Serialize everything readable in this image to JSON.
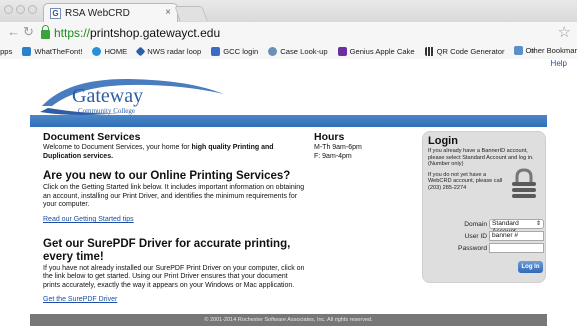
{
  "browser": {
    "tab_title": "RSA WebCRD",
    "tab_favicon": "G",
    "tab_close": "×",
    "url_scheme": "https://",
    "url_host": "printshop.gatewayct.edu",
    "bookmarks": [
      {
        "label": "Apps",
        "icon": "apps-grid-icon",
        "color": "#3a7bd5"
      },
      {
        "label": "WhatTheFont!",
        "icon": "whatthefont-icon",
        "color": "#2e7fc9"
      },
      {
        "label": "HOME",
        "icon": "home-icon",
        "color": "#2a8fd9"
      },
      {
        "label": "NWS radar loop",
        "icon": "nws-icon",
        "color": "#2b5ea8"
      },
      {
        "label": "GCC login",
        "icon": "gcc-icon",
        "color": "#3b6bc7"
      },
      {
        "label": "Case Look-up",
        "icon": "case-lookup-icon",
        "color": "#6b8fb5"
      },
      {
        "label": "Genius Apple Cake",
        "icon": "yahoo-icon",
        "color": "#6b2fa0"
      },
      {
        "label": "QR Code Generator",
        "icon": "qr-code-icon",
        "color": "#333333"
      }
    ],
    "bookmarks_overflow": "»",
    "other_bookmarks": "Other Bookmar"
  },
  "page": {
    "help": "Help",
    "logo": {
      "name": "Gateway",
      "sub": "Community College"
    },
    "document_services": {
      "title": "Document Services",
      "body_prefix": "Welcome to Document Services, your home for ",
      "body_bold": "high quality Printing and Duplication services."
    },
    "new_users": {
      "title": "Are you new to our Online Printing Services?",
      "body": "Click on the Getting Started link below. It includes important information on obtaining an account, installing our Print Driver, and identifies the minimum requirements for your computer.",
      "link": "Read our Getting Started tips"
    },
    "surepdf": {
      "title": "Get our SurePDF Driver for accurate printing, every time!",
      "body": "If you have not already installed our SurePDF Print Driver on your computer, click on the link below to get started. Using our Print Driver ensures that your document prints accurately, exactly the way it appears on your Windows or Mac application.",
      "link": "Get the SurePDF Driver"
    },
    "hours": {
      "title": "Hours",
      "line1": "M-Th 9am-6pm",
      "line2": "F: 9am-4pm"
    },
    "login": {
      "title": "Login",
      "info1": "If you already have a BannerID account, please select Standard Account and log in. (Number only)",
      "info2": "If you do not yet have a WebCRD account, please call (203) 285-2274",
      "domain_label": "Domain",
      "domain_value": "Standard Account",
      "userid_label": "User ID",
      "userid_value": "banner #",
      "password_label": "Password",
      "password_value": "",
      "button": "Log In"
    },
    "footer": "© 2001-2014 Rochester Software Associates, Inc. All rights reserved."
  },
  "colors": {
    "banner": "#3a78be",
    "link": "#1c4fa6",
    "footer": "#777777",
    "logo_blue": "#4a7cc0"
  }
}
